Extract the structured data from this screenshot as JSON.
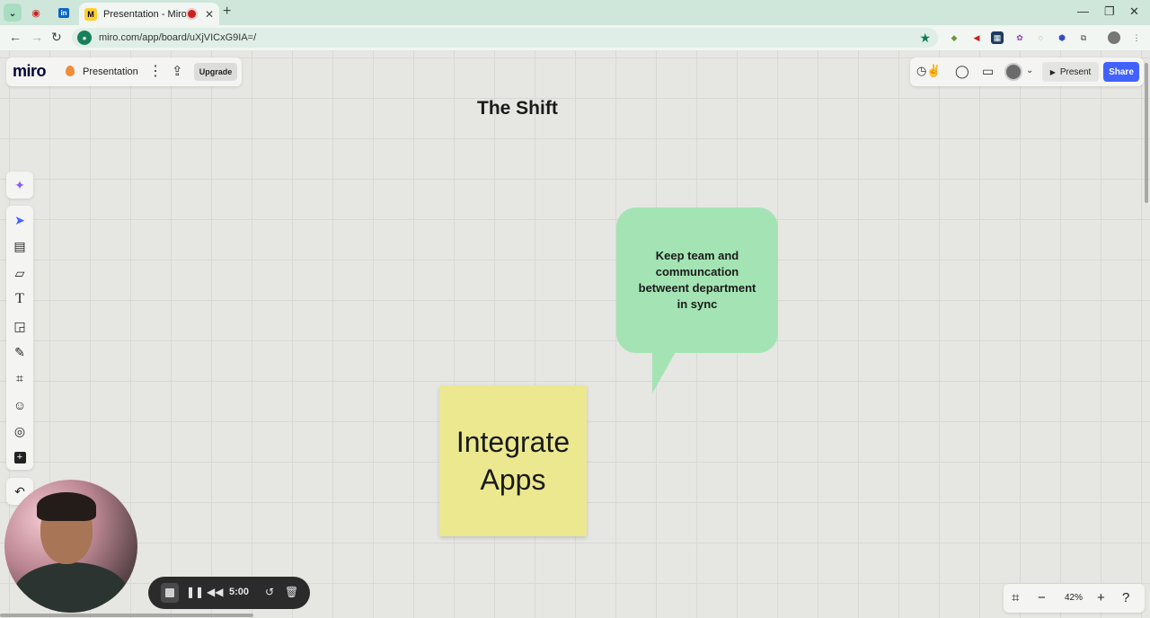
{
  "browser": {
    "tab_title": "Presentation - Miro",
    "tab_favicon": "miro-logo-icon",
    "url": "miro.com/app/board/uXjVICxG9IA=/",
    "pinned_tabs": [
      "tab-menu-icon",
      "record-tab-icon",
      "linkedin-icon"
    ],
    "extensions": [
      "gem-icon",
      "megaphone-icon",
      "qr-icon",
      "badge-icon",
      "circle-icon",
      "shield-icon",
      "puzzle-icon",
      "profile-icon"
    ]
  },
  "miro": {
    "logo": "miro",
    "board_name": "Presentation",
    "upgrade_label": "Upgrade",
    "reactions_icon": "emoji-reactions-icon",
    "present_label": "Present",
    "share_label": "Share",
    "accent_color": "#4262ff"
  },
  "board": {
    "title": "The Shift",
    "bubble_text": "Keep team and\ncommuncation\nbetweent department\nin sync",
    "bubble_color": "#a4e4b4",
    "sticky_text": "Integrate\nApps",
    "sticky_color": "#ece88f"
  },
  "toolbar": {
    "tools": [
      "ai-sparkle-icon",
      "select-icon",
      "templates-icon",
      "sticky-note-icon",
      "text-icon",
      "shapes-icon",
      "pen-icon",
      "frame-icon",
      "stickers-icon",
      "comment-icon",
      "more-tools-icon",
      "undo-icon"
    ]
  },
  "recorder": {
    "time": "5:00"
  },
  "zoom": {
    "value": "42%"
  }
}
